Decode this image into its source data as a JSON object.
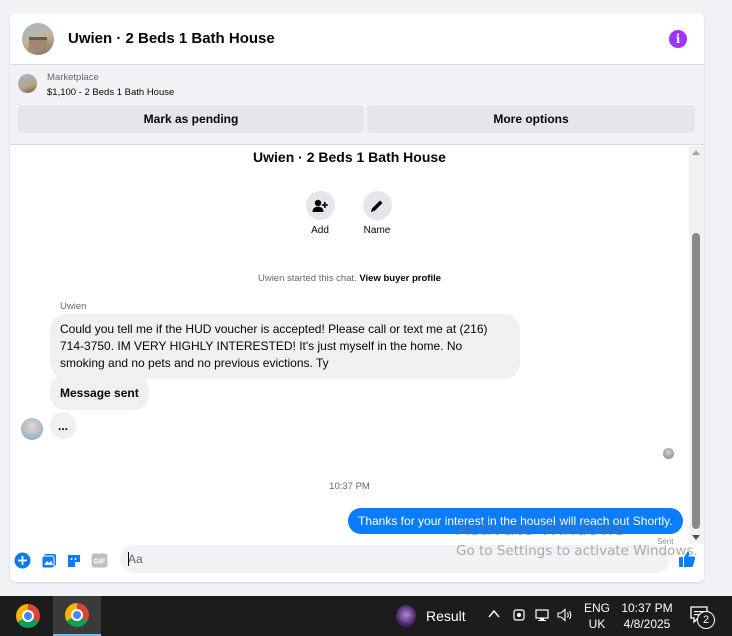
{
  "header": {
    "title": "Uwien · 2 Beds 1 Bath House",
    "info_icon": "info-icon",
    "accent_color": "#a033ff"
  },
  "listing": {
    "source": "Marketplace",
    "title": "$1,100 - 2 Beds 1 Bath House",
    "pending_button": "Mark as pending",
    "more_button": "More options"
  },
  "conversation": {
    "title": "Uwien · 2 Beds 1 Bath House",
    "actions": [
      {
        "label": "Add",
        "icon": "add-person-icon"
      },
      {
        "label": "Name",
        "icon": "pencil-icon"
      }
    ],
    "started_text": "Uwien started this chat.",
    "buyer_profile_link": "View buyer profile"
  },
  "messages": {
    "sender_name": "Uwien",
    "incoming_text": "Could you tell me if the HUD voucher is accepted! Please call or text me at (216) 714-3750. IM VERY HIGHLY INTERESTED! It's just myself in the home. No smoking and no pets and no previous evictions. Ty",
    "auto_reply": "Message sent",
    "typing": "...",
    "timestamp": "10:37 PM",
    "outgoing_text": "Thanks for your interest in the houseI will reach out Shortly.",
    "status": "Sent",
    "outgoing_color": "#0a7cff"
  },
  "composer": {
    "placeholder": "Aa",
    "icons": [
      "add-icon",
      "photo-icon",
      "sticker-icon",
      "gif-icon",
      "emoji-icon",
      "like-icon"
    ],
    "gif_label": "GIF"
  },
  "watermark": {
    "title": "Activate Windows",
    "subtitle": "Go to Settings to activate Windows."
  },
  "taskbar": {
    "result_label": "Result",
    "language": "ENG",
    "region": "UK",
    "time": "10:37 PM",
    "date": "4/8/2025",
    "notification_count": "2"
  }
}
